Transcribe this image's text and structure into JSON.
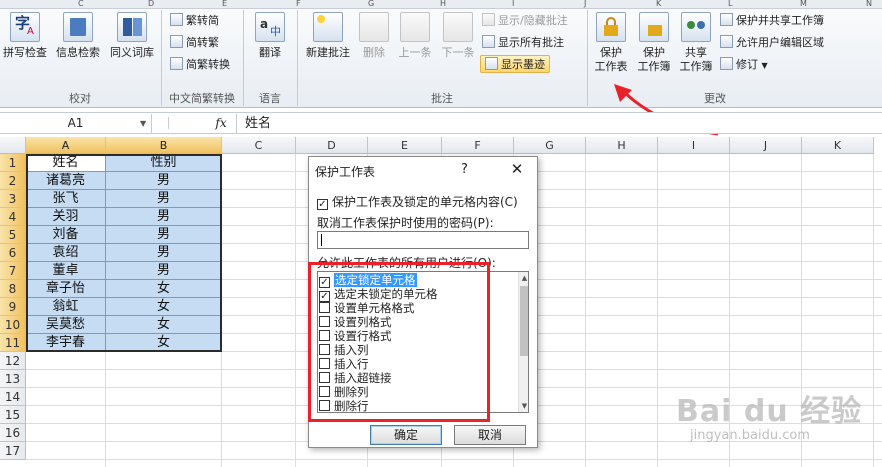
{
  "ribbon": {
    "col_letters": [
      "C",
      "D",
      "E",
      "F",
      "G",
      "H",
      "I",
      "J",
      "K",
      "L",
      "M",
      "N"
    ],
    "groups": {
      "proofing": {
        "label": "校对",
        "spelling": "拼写检查",
        "research": "信息检索",
        "thesaurus": "同义词库"
      },
      "chinese_conversion": {
        "label": "中文简繁转换",
        "to_simplified": "繁转简",
        "to_traditional": "简转繁",
        "convert": "简繁转换"
      },
      "language": {
        "label": "语言",
        "translate": "翻译"
      },
      "comments": {
        "label": "批注",
        "new_comment": "新建批注",
        "delete": "删除",
        "previous": "上一条",
        "next": "下一条",
        "show_hide": "显示/隐藏批注",
        "show_all": "显示所有批注",
        "show_ink": "显示墨迹"
      },
      "changes": {
        "label": "更改",
        "protect_sheet_line1": "保护",
        "protect_sheet_line2": "工作表",
        "protect_workbook_line1": "保护",
        "protect_workbook_line2": "工作簿",
        "share_workbook_line1": "共享",
        "share_workbook_line2": "工作簿",
        "protect_and_share": "保护并共享工作簿",
        "allow_edit_ranges": "允许用户编辑区域",
        "track_changes": "修订"
      }
    }
  },
  "formula_bar": {
    "name_box": "A1",
    "fx": "fx",
    "content": "姓名"
  },
  "sheet": {
    "columns": [
      "A",
      "B",
      "C",
      "D",
      "E",
      "F",
      "G",
      "H",
      "I",
      "J",
      "K"
    ],
    "rows": [
      "1",
      "2",
      "3",
      "4",
      "5",
      "6",
      "7",
      "8",
      "9",
      "10",
      "11",
      "12",
      "13",
      "14",
      "15",
      "16",
      "17"
    ],
    "data": [
      [
        "姓名",
        "性别"
      ],
      [
        "诸葛亮",
        "男"
      ],
      [
        "张飞",
        "男"
      ],
      [
        "关羽",
        "男"
      ],
      [
        "刘备",
        "男"
      ],
      [
        "袁绍",
        "男"
      ],
      [
        "董卓",
        "男"
      ],
      [
        "章子怡",
        "女"
      ],
      [
        "翁虹",
        "女"
      ],
      [
        "吴莫愁",
        "女"
      ],
      [
        "李宇春",
        "女"
      ]
    ]
  },
  "dialog": {
    "title": "保护工作表",
    "help": "?",
    "close": "✕",
    "protect_label": "保护工作表及锁定的单元格内容(C)",
    "protect_checked": true,
    "password_label": "取消工作表保护时使用的密码(P):",
    "password_value": "",
    "allow_label": "允许此工作表的所有用户进行(O):",
    "permissions": [
      {
        "label": "选定锁定单元格",
        "checked": true
      },
      {
        "label": "选定未锁定的单元格",
        "checked": true
      },
      {
        "label": "设置单元格格式",
        "checked": false
      },
      {
        "label": "设置列格式",
        "checked": false
      },
      {
        "label": "设置行格式",
        "checked": false
      },
      {
        "label": "插入列",
        "checked": false
      },
      {
        "label": "插入行",
        "checked": false
      },
      {
        "label": "插入超链接",
        "checked": false
      },
      {
        "label": "删除列",
        "checked": false
      },
      {
        "label": "删除行",
        "checked": false
      }
    ],
    "ok": "确定",
    "cancel": "取消"
  },
  "watermark": {
    "brand": "Bai du 经验",
    "url": "jingyan.baidu.com"
  },
  "colors": {
    "selection_fill": "#c5dcf3",
    "header_highlight": "#f1c15f",
    "annotation_red": "#e8212a"
  }
}
